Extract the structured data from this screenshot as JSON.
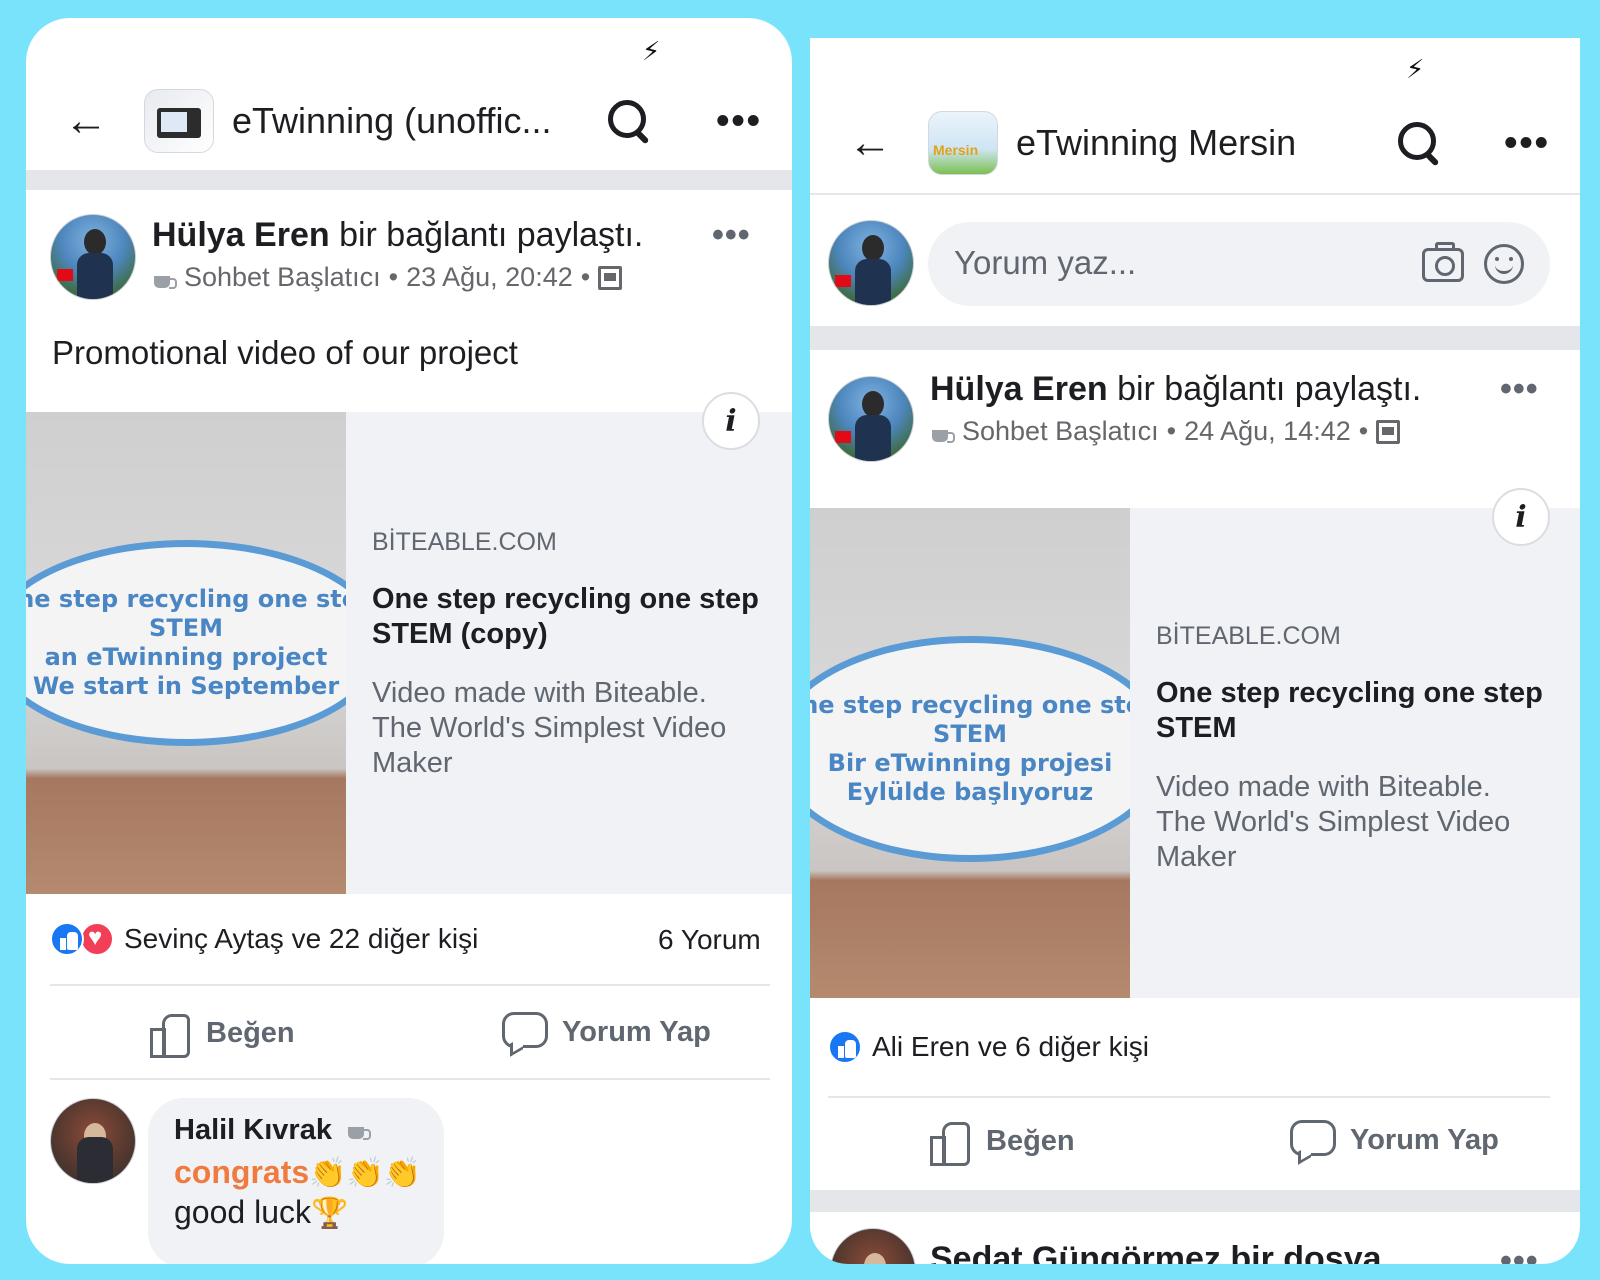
{
  "left": {
    "header": {
      "group_name": "eTwinning (unoffic..."
    },
    "post": {
      "author": "Hülya Eren",
      "action": "bir bağlantı paylaştı.",
      "badge": "Sohbet Başlatıcı",
      "separator": "•",
      "timestamp": "23 Ağu, 20:42",
      "text": "Promotional video of our project",
      "link": {
        "domain": "BİTEABLE.COM",
        "title": "One step recycling one step STEM (copy)",
        "description": "Video made with Biteable. The World's Simplest Video Maker",
        "thumb_lines": [
          "One step recycling one step",
          "STEM",
          "an eTwinning project",
          "We start in September"
        ]
      },
      "reactions_label": "Sevinç Aytaş ve 22 diğer kişi",
      "comment_count": "6 Yorum",
      "like_label": "Beğen",
      "comment_label": "Yorum Yap"
    },
    "comment": {
      "author": "Halil Kıvrak",
      "line1": "congrats",
      "line2": "good luck"
    }
  },
  "right": {
    "header": {
      "group_name": "eTwinning Mersin"
    },
    "composer": {
      "placeholder": "Yorum yaz..."
    },
    "post": {
      "author": "Hülya Eren",
      "action": "bir bağlantı paylaştı.",
      "badge": "Sohbet Başlatıcı",
      "separator": "•",
      "timestamp": "24 Ağu, 14:42",
      "link": {
        "domain": "BİTEABLE.COM",
        "title": "One step recycling one step STEM",
        "description": "Video made with Biteable. The World's Simplest Video Maker",
        "thumb_lines": [
          "One step recycling one step",
          "STEM",
          "Bir eTwinning projesi",
          "Eylülde başlıyoruz"
        ]
      },
      "reactions_label": "Ali Eren ve 6 diğer kişi",
      "like_label": "Beğen",
      "comment_label": "Yorum Yap"
    },
    "next_post_author": "Sedat Güngörmez bir dosya"
  },
  "icons": {
    "status": "charging-bolt-icon",
    "back": "back-arrow-icon",
    "search": "search-icon",
    "more": "more-dots-icon",
    "like": "like-thumb-icon",
    "love": "love-heart-icon",
    "comment": "comment-bubble-icon",
    "camera": "camera-icon",
    "emoji": "emoji-smile-icon",
    "info": "info-icon",
    "badge": "coffee-cup-icon",
    "privacy": "group-privacy-icon"
  },
  "colors": {
    "background": "#79e3fb",
    "like_blue": "#1877f2",
    "love_red": "#f33e58",
    "congrats_orange": "#f07b3f",
    "patch_blue": "#5a9bd6"
  }
}
